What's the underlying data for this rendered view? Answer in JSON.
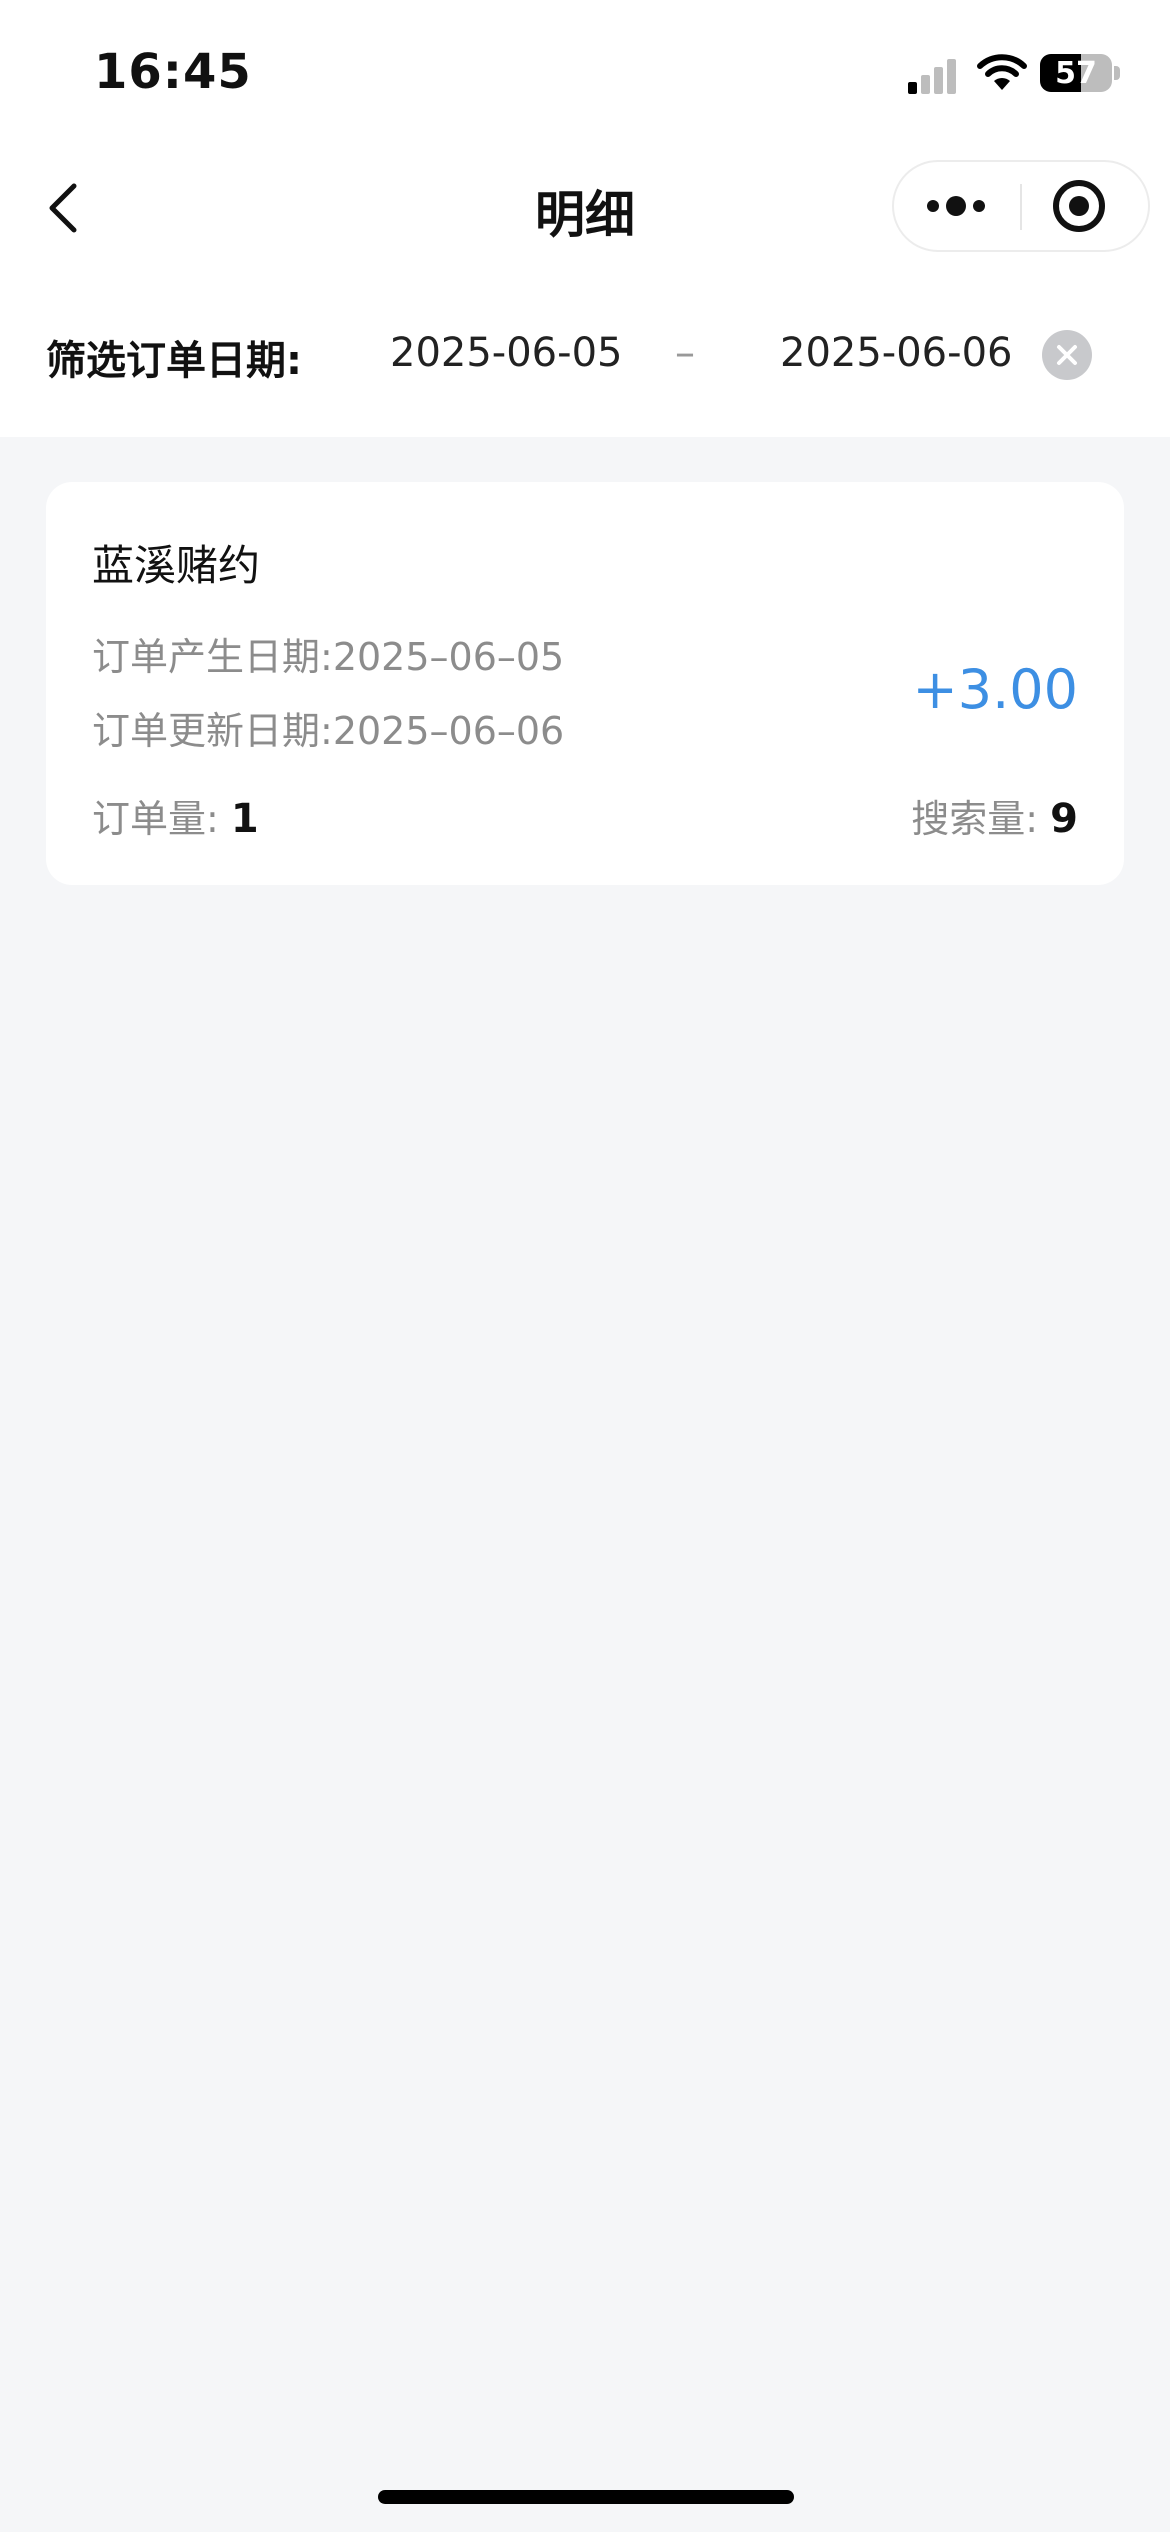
{
  "status_bar": {
    "time": "16:45",
    "battery_level": "57",
    "battery_fraction": 0.57
  },
  "nav": {
    "title": "明细",
    "back_icon": "chevron-left-icon",
    "more_icon": "more-dots-icon",
    "close_icon": "target-circle-icon"
  },
  "filter": {
    "label": "筛选订单日期:",
    "start_date": "2025-06-05",
    "separator": "–",
    "end_date": "2025-06-06",
    "clear_icon": "close-circle-icon"
  },
  "records": [
    {
      "title": "蓝溪赌约",
      "created_label": "订单产生日期:",
      "created_value": "2025–06–05",
      "updated_label": "订单更新日期:",
      "updated_value": "2025–06–06",
      "amount": "+3.00",
      "order_count_label": "订单量:",
      "order_count": "1",
      "search_count_label": "搜索量:",
      "search_count": "9"
    }
  ],
  "colors": {
    "accent": "#3d8fe3",
    "background": "#f5f6f8",
    "muted_text": "#8c8c8c"
  }
}
